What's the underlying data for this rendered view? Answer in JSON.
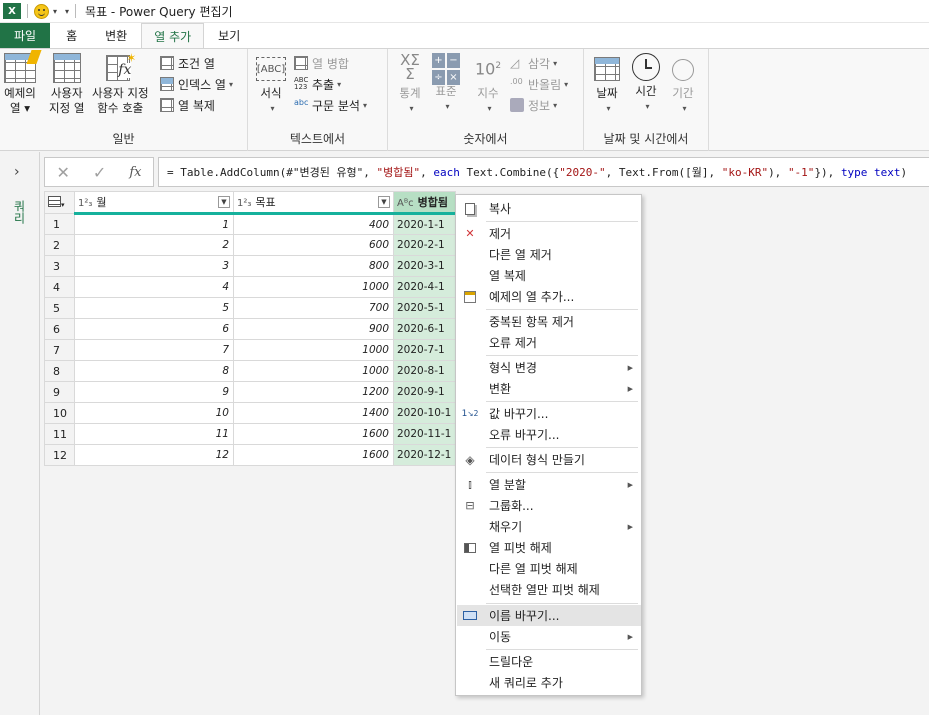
{
  "titlebar": {
    "app_icon": "X",
    "title": "목표 - Power Query 편집기"
  },
  "tabs": [
    {
      "label": "파일"
    },
    {
      "label": "홈"
    },
    {
      "label": "변환"
    },
    {
      "label": "열 추가"
    },
    {
      "label": "보기"
    }
  ],
  "ribbon": {
    "general": {
      "label": "일반",
      "example_col": {
        "line1": "예제의",
        "line2": "열 ▾"
      },
      "custom_col": {
        "line1": "사용자",
        "line2": "지정 열"
      },
      "invoke_fn": {
        "line1": "사용자 지정",
        "line2": "함수 호출"
      },
      "conditional_col": "조건 열",
      "index_col": "인덱스 열",
      "duplicate_col": "열 복제"
    },
    "text": {
      "label": "텍스트에서",
      "format": "서식",
      "merge_cols": "열 병합",
      "extract": "추출",
      "parse": "구문 분석"
    },
    "number": {
      "label": "숫자에서",
      "statistics": "통계",
      "standard": "표준",
      "scientific": "지수",
      "trig": "삼각",
      "rounding": "반올림",
      "info": "정보"
    },
    "datetime": {
      "label": "날짜 및 시간에서",
      "date": "날짜",
      "time": "시간",
      "duration": "기간"
    }
  },
  "leftnav": {
    "queries_label": "쿼리"
  },
  "formula": {
    "part1": "= Table.AddColumn(#\"변경된 유형\", ",
    "str1": "\"병합됨\"",
    "part2": ", ",
    "kw1": "each",
    "part3": " Text.Combine({",
    "str2": "\"2020-\"",
    "part4": ", Text.From([월], ",
    "str3": "\"ko-KR\"",
    "part5": "), ",
    "str4": "\"-1\"",
    "part6": "}), ",
    "kw2": "type text",
    "part7": ")"
  },
  "grid": {
    "columns": [
      {
        "type": "1²₃",
        "name": "월"
      },
      {
        "type": "1²₃",
        "name": "목표"
      },
      {
        "type": "Aᴮc",
        "name": "병합됨"
      }
    ],
    "rows": [
      {
        "n": "1",
        "month": "1",
        "goal": "400",
        "merged": "2020-1-1"
      },
      {
        "n": "2",
        "month": "2",
        "goal": "600",
        "merged": "2020-2-1"
      },
      {
        "n": "3",
        "month": "3",
        "goal": "800",
        "merged": "2020-3-1"
      },
      {
        "n": "4",
        "month": "4",
        "goal": "1000",
        "merged": "2020-4-1"
      },
      {
        "n": "5",
        "month": "5",
        "goal": "700",
        "merged": "2020-5-1"
      },
      {
        "n": "6",
        "month": "6",
        "goal": "900",
        "merged": "2020-6-1"
      },
      {
        "n": "7",
        "month": "7",
        "goal": "1000",
        "merged": "2020-7-1"
      },
      {
        "n": "8",
        "month": "8",
        "goal": "1000",
        "merged": "2020-8-1"
      },
      {
        "n": "9",
        "month": "9",
        "goal": "1200",
        "merged": "2020-9-1"
      },
      {
        "n": "10",
        "month": "10",
        "goal": "1400",
        "merged": "2020-10-1"
      },
      {
        "n": "11",
        "month": "11",
        "goal": "1600",
        "merged": "2020-11-1"
      },
      {
        "n": "12",
        "month": "12",
        "goal": "1600",
        "merged": "2020-12-1"
      }
    ]
  },
  "context_menu": {
    "copy": "복사",
    "remove": "제거",
    "remove_other": "다른 열 제거",
    "duplicate": "열 복제",
    "add_from_examples": "예제의 열 추가...",
    "remove_duplicates": "중복된 항목 제거",
    "remove_errors": "오류 제거",
    "change_type": "형식 변경",
    "transform": "변환",
    "replace_values": "값 바꾸기...",
    "replace_errors": "오류 바꾸기...",
    "create_data_type": "데이터 형식 만들기",
    "split_column": "열 분할",
    "group_by": "그룹화...",
    "fill": "채우기",
    "unpivot": "열 피벗 해제",
    "unpivot_other": "다른 열 피벗 해제",
    "unpivot_selected": "선택한 열만 피벗 해제",
    "rename": "이름 바꾸기...",
    "move": "이동",
    "drill_down": "드릴다운",
    "add_as_new_query": "새 쿼리로 추가"
  }
}
